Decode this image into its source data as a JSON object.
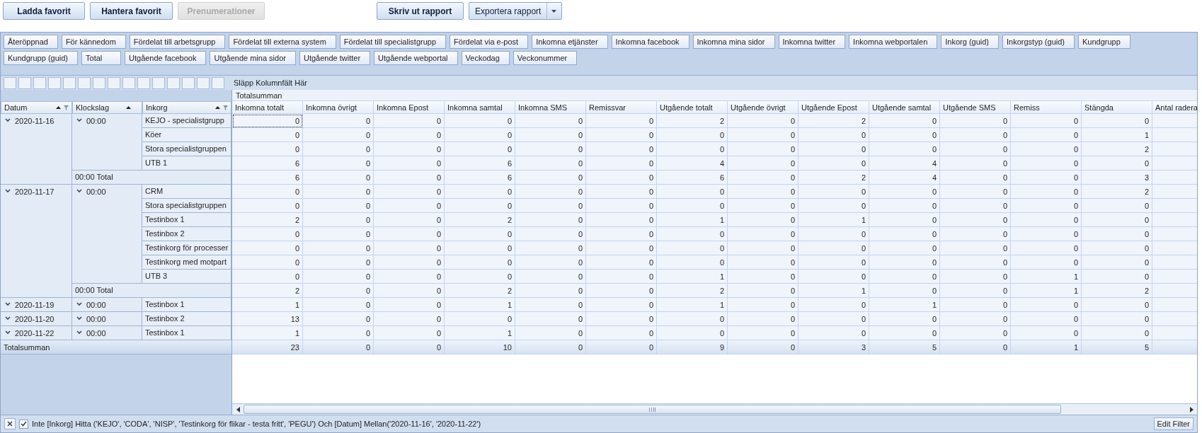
{
  "toolbar": {
    "buttons": [
      {
        "label": "Ladda favorit",
        "disabled": false
      },
      {
        "label": "Hantera favorit",
        "disabled": false
      },
      {
        "label": "Prenumerationer",
        "disabled": true
      }
    ],
    "report_buttons": [
      {
        "label": "Skriv ut rapport",
        "kind": "button"
      },
      {
        "label": "Exportera rapport",
        "kind": "dropdown"
      }
    ]
  },
  "field_list": [
    "Återöppnad",
    "För kännedom",
    "Fördelat till arbetsgrupp",
    "Fördelat till externa system",
    "Fördelat till specialistgrupp",
    "Fördelat via e-post",
    "Inkomna etjänster",
    "Inkomna facebook",
    "Inkomna mina sidor",
    "Inkomna twitter",
    "Inkomna webportalen",
    "Inkorg (guid)",
    "Inkorgstyp (guid)",
    "Kundgrupp",
    "Kundgrupp (guid)",
    "Total",
    "Utgående facebook",
    "Utgående mina sidor",
    "Utgående twitter",
    "Utgående webportal",
    "Veckodag",
    "Veckonummer"
  ],
  "column_area": {
    "placeholder": "Släpp Kolumnfält Här"
  },
  "row_fields": [
    {
      "label": "Datum",
      "sort_ascending": true,
      "filtered": true
    },
    {
      "label": "Klockslag",
      "sort_ascending": true,
      "filtered": false
    },
    {
      "label": "Inkorg",
      "sort_ascending": true,
      "filtered": true
    }
  ],
  "grand_total_header": "Totalsumman",
  "columns": [
    "Inkomna totalt",
    "Inkomna övrigt",
    "Inkomna Epost",
    "Inkomna samtal",
    "Inkomna SMS",
    "Remissvar",
    "Utgående totalt",
    "Utgående övrigt",
    "Utgående Epost",
    "Utgående samtal",
    "Utgående SMS",
    "Remiss",
    "Stängda",
    "Antal radera"
  ],
  "groups": [
    {
      "date": "2020-11-16",
      "expanded": true,
      "times": [
        {
          "time": "00:00",
          "expanded": true,
          "inboxes": [
            {
              "name": "KEJO - specialistgrupp",
              "values": [
                "0",
                "0",
                "0",
                "0",
                "0",
                "0",
                "2",
                "0",
                "2",
                "0",
                "0",
                "0",
                "0"
              ]
            },
            {
              "name": "Köer",
              "values": [
                "0",
                "0",
                "0",
                "0",
                "0",
                "0",
                "0",
                "0",
                "0",
                "0",
                "0",
                "0",
                "1"
              ]
            },
            {
              "name": "Stora specialistgruppen",
              "values": [
                "0",
                "0",
                "0",
                "0",
                "0",
                "0",
                "0",
                "0",
                "0",
                "0",
                "0",
                "0",
                "2"
              ]
            },
            {
              "name": "UTB 1",
              "values": [
                "6",
                "0",
                "0",
                "6",
                "0",
                "0",
                "4",
                "0",
                "0",
                "4",
                "0",
                "0",
                "0"
              ]
            }
          ],
          "total": {
            "label": "00:00 Total",
            "values": [
              "6",
              "0",
              "0",
              "6",
              "0",
              "0",
              "6",
              "0",
              "2",
              "4",
              "0",
              "0",
              "3"
            ]
          }
        }
      ]
    },
    {
      "date": "2020-11-17",
      "expanded": true,
      "times": [
        {
          "time": "00:00",
          "expanded": true,
          "inboxes": [
            {
              "name": "CRM",
              "values": [
                "0",
                "0",
                "0",
                "0",
                "0",
                "0",
                "0",
                "0",
                "0",
                "0",
                "0",
                "0",
                "2"
              ]
            },
            {
              "name": "Stora specialistgruppen",
              "values": [
                "0",
                "0",
                "0",
                "0",
                "0",
                "0",
                "0",
                "0",
                "0",
                "0",
                "0",
                "0",
                "0"
              ]
            },
            {
              "name": "Testinbox 1",
              "values": [
                "2",
                "0",
                "0",
                "2",
                "0",
                "0",
                "1",
                "0",
                "1",
                "0",
                "0",
                "0",
                "0"
              ]
            },
            {
              "name": "Testinbox 2",
              "values": [
                "0",
                "0",
                "0",
                "0",
                "0",
                "0",
                "0",
                "0",
                "0",
                "0",
                "0",
                "0",
                "0"
              ]
            },
            {
              "name": "Testinkorg för processer",
              "values": [
                "0",
                "0",
                "0",
                "0",
                "0",
                "0",
                "0",
                "0",
                "0",
                "0",
                "0",
                "0",
                "0"
              ]
            },
            {
              "name": "Testinkorg med motpart",
              "values": [
                "0",
                "0",
                "0",
                "0",
                "0",
                "0",
                "0",
                "0",
                "0",
                "0",
                "0",
                "0",
                "0"
              ]
            },
            {
              "name": "UTB 3",
              "values": [
                "0",
                "0",
                "0",
                "0",
                "0",
                "0",
                "1",
                "0",
                "0",
                "0",
                "0",
                "1",
                "0"
              ]
            }
          ],
          "total": {
            "label": "00:00 Total",
            "values": [
              "2",
              "0",
              "0",
              "2",
              "0",
              "0",
              "2",
              "0",
              "1",
              "0",
              "0",
              "1",
              "2"
            ]
          }
        }
      ]
    },
    {
      "date": "2020-11-19",
      "expanded": true,
      "times": [
        {
          "time": "00:00",
          "expanded": true,
          "inboxes": [
            {
              "name": "Testinbox 1",
              "values": [
                "1",
                "0",
                "0",
                "1",
                "0",
                "0",
                "1",
                "0",
                "0",
                "1",
                "0",
                "0",
                "0"
              ]
            }
          ]
        }
      ]
    },
    {
      "date": "2020-11-20",
      "expanded": true,
      "times": [
        {
          "time": "00:00",
          "expanded": true,
          "inboxes": [
            {
              "name": "Testinbox 2",
              "values": [
                "13",
                "0",
                "0",
                "0",
                "0",
                "0",
                "0",
                "0",
                "0",
                "0",
                "0",
                "0",
                "0"
              ]
            }
          ]
        }
      ]
    },
    {
      "date": "2020-11-22",
      "expanded": true,
      "times": [
        {
          "time": "00:00",
          "expanded": true,
          "inboxes": [
            {
              "name": "Testinbox 1",
              "values": [
                "1",
                "0",
                "0",
                "1",
                "0",
                "0",
                "0",
                "0",
                "0",
                "0",
                "0",
                "0",
                "0"
              ]
            }
          ]
        }
      ]
    }
  ],
  "grand_total": {
    "label": "Totalsumman",
    "values": [
      "23",
      "0",
      "0",
      "10",
      "0",
      "0",
      "9",
      "0",
      "3",
      "5",
      "0",
      "1",
      "5"
    ]
  },
  "filter_bar": {
    "enabled": true,
    "expression": "Inte [Inkorg] Hitta ('KEJO', 'CODA', 'NISP', 'Testinkorg för flikar - testa fritt', 'PEGU') Och [Datum] Mellan('2020-11-16', '2020-11-22')",
    "edit_button": "Edit Filter"
  }
}
